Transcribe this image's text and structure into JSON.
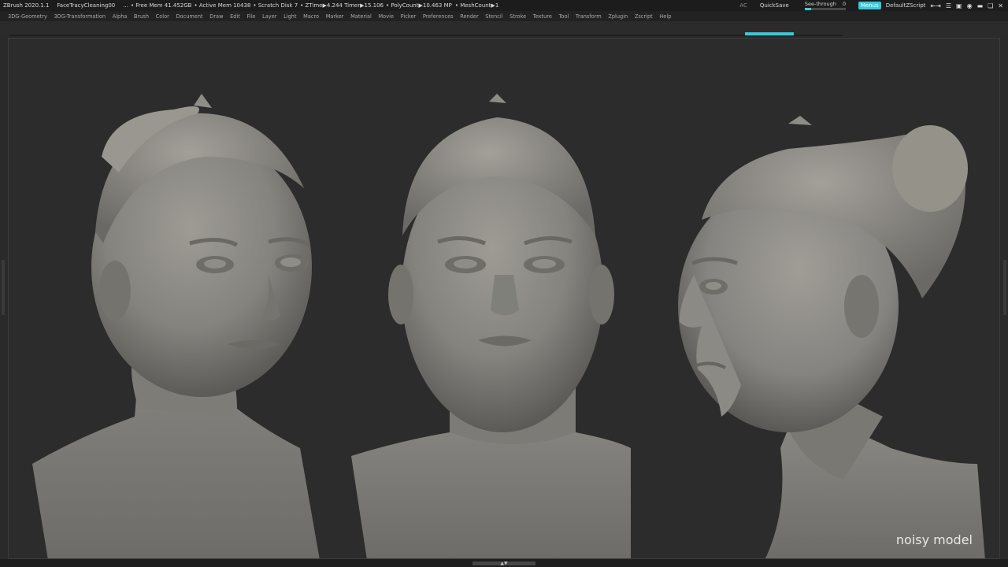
{
  "titlebar": {
    "app": "ZBrush 2020.1.1",
    "document": "FaceTracyCleaning00",
    "ellipsis": "...",
    "free_mem": "• Free Mem 41.452GB",
    "active_mem": "• Active Mem 10438",
    "scratch_disk": "• Scratch Disk 7",
    "ztime": "•  ZTime▶4.244 Timer▶15.106",
    "polycount": "• PolyCount▶10.463 MP",
    "meshcount": "• MeshCount▶1",
    "ac_label": "AC",
    "quicksave_label": "QuickSave",
    "see_through_label": "See-through",
    "see_through_value": "0",
    "see_through_level": 0.15,
    "menus_label": "Menus",
    "script_label": "DefaultZScript"
  },
  "menubar": {
    "items": [
      "3DG-Geometry",
      "3DG-Transformation",
      "Alpha",
      "Brush",
      "Color",
      "Document",
      "Draw",
      "Edit",
      "File",
      "Layer",
      "Light",
      "Macro",
      "Marker",
      "Material",
      "Movie",
      "Picker",
      "Preferences",
      "Render",
      "Stencil",
      "Stroke",
      "Texture",
      "Tool",
      "Transform",
      "Zplugin",
      "Zscript",
      "Help"
    ]
  },
  "canvas": {
    "caption": "noisy model",
    "model_color": "#8a8883",
    "background_color": "#2c2c2c"
  },
  "colors": {
    "accent": "#37c9d9",
    "titlebar_bg": "#1c1c1c",
    "menubar_bg": "#222222"
  }
}
